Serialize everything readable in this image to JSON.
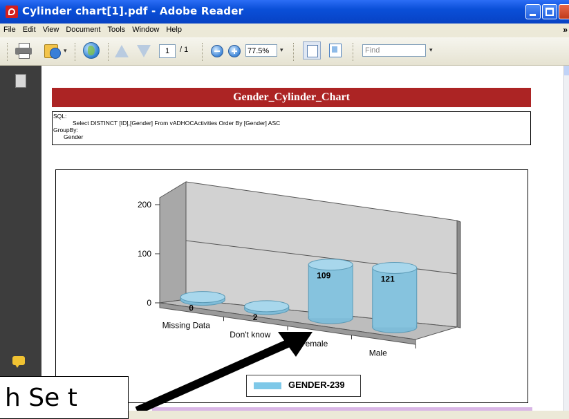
{
  "window": {
    "title": "Cylinder chart[1].pdf - Adobe Reader"
  },
  "menu": [
    "File",
    "Edit",
    "View",
    "Document",
    "Tools",
    "Window",
    "Help"
  ],
  "toolbar": {
    "page_current": "1",
    "page_total": "/ 1",
    "zoom": "77.5%",
    "find_placeholder": "Find"
  },
  "report": {
    "title": "Gender_Cylinder_Chart",
    "sql_label": "SQL:",
    "sql_text": "Select  DISTINCT [ID],[Gender] From vADHOCActivities  Order By [Gender] ASC",
    "groupby_label": "GroupBy:",
    "groupby_value": "Gender"
  },
  "chart_data": {
    "type": "bar",
    "style": "3d-cylinder",
    "categories": [
      "Missing Data",
      "Don't know",
      "Female",
      "Male"
    ],
    "series": [
      {
        "name": "GENDER-239",
        "values": [
          0,
          2,
          109,
          121
        ],
        "color": "#7ec8e8"
      }
    ],
    "data_labels": [
      "0",
      "2",
      "109",
      "121"
    ],
    "yticks": [
      "0",
      "100",
      "200"
    ],
    "ylim": [
      0,
      200
    ],
    "legend_position": "bottom"
  },
  "overlay": {
    "callout_text": "h Se t"
  }
}
